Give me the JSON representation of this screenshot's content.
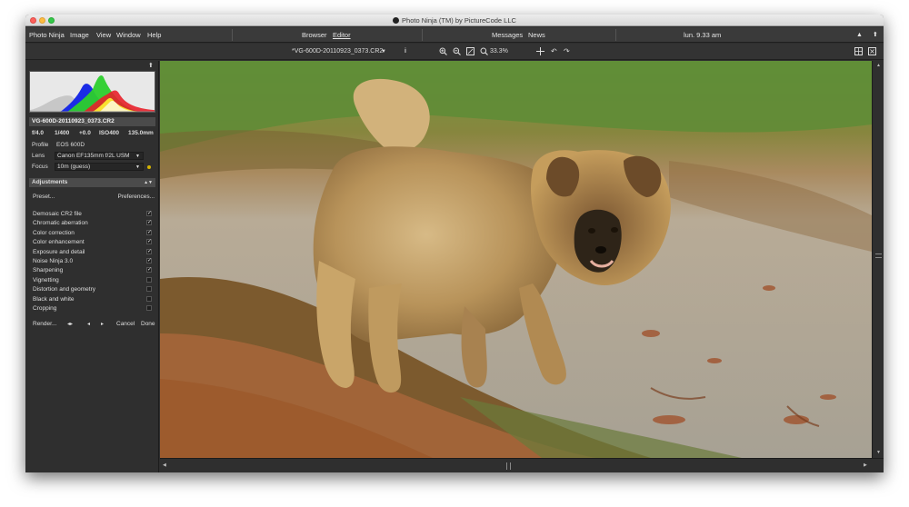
{
  "window": {
    "title": "Photo Ninja (TM) by PictureCode LLC"
  },
  "menu": {
    "items": [
      "Photo Ninja",
      "Image",
      "View",
      "Window",
      "Help"
    ],
    "browser": "Browser",
    "editor": "Editor",
    "messages": "Messages",
    "news": "News",
    "clock": "lun. 9.33 am"
  },
  "toolbar": {
    "filename": "*VG-600D-20110923_0373.CR2",
    "zoom_level": "33.3%"
  },
  "sidebar": {
    "file_name": "VG-600D-20110923_0373.CR2",
    "exposure": {
      "aperture": "f/4.0",
      "shutter": "1/400",
      "ev": "+0.0",
      "iso": "ISO400",
      "focal": "135.0mm"
    },
    "profile_label": "Profile",
    "profile_value": "EOS 600D",
    "lens_label": "Lens",
    "lens_value": "Canon EF135mm f/2L USM",
    "focus_label": "Focus",
    "focus_value": "10m (guess)",
    "adjustments_title": "Adjustments",
    "preset_label": "Preset...",
    "preferences_label": "Preferences...",
    "adjustments": [
      {
        "label": "Demosaic CR2 file",
        "checked": true
      },
      {
        "label": "Chromatic aberration",
        "checked": true
      },
      {
        "label": "Color correction",
        "checked": true
      },
      {
        "label": "Color enhancement",
        "checked": true
      },
      {
        "label": "Exposure and detail",
        "checked": true
      },
      {
        "label": "Noise Ninja 3.0",
        "checked": true
      },
      {
        "label": "Sharpening",
        "checked": true
      },
      {
        "label": "Vignetting",
        "checked": false
      },
      {
        "label": "Distortion and geometry",
        "checked": false
      },
      {
        "label": "Black and white",
        "checked": false
      },
      {
        "label": "Cropping",
        "checked": false
      }
    ],
    "render_label": "Render...",
    "cancel_label": "Cancel",
    "done_label": "Done"
  },
  "colors": {
    "chrome_dark": "#2e2e2e",
    "panel_header": "#4b4b4b",
    "focus_dot": "#d4b400",
    "histogram_red": "#e8202a",
    "histogram_green": "#2ccf2c",
    "histogram_blue": "#1a2be6"
  }
}
